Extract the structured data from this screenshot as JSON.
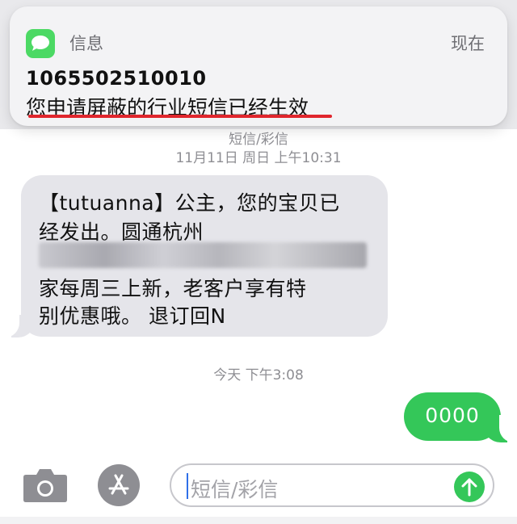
{
  "banner": {
    "app_name": "信息",
    "time": "现在",
    "sender": "1065502510010",
    "body": "您申请屏蔽的行业短信已经生效",
    "icon": "messages-app-icon"
  },
  "conversation": {
    "service_label": "短信/彩信",
    "timestamp_1": "11月11日 周日 上午10:31",
    "incoming": {
      "line1": "【tutuanna】公主，您的宝贝已",
      "line2": "经发出。圆通杭州",
      "line3_redacted": true,
      "line4": "家每周三上新，老客户享有特",
      "line5": "别优惠哦。 退订回N"
    },
    "timestamp_2": "今天 下午3:08",
    "outgoing": {
      "text": "0000"
    }
  },
  "input_bar": {
    "placeholder": "短信/彩信",
    "icons": [
      "camera-icon",
      "app-store-icon",
      "send-arrow-icon"
    ]
  },
  "colors": {
    "accent_green": "#34c759",
    "underline_red": "#e0262d",
    "incoming_bubble": "#e5e5ea"
  }
}
